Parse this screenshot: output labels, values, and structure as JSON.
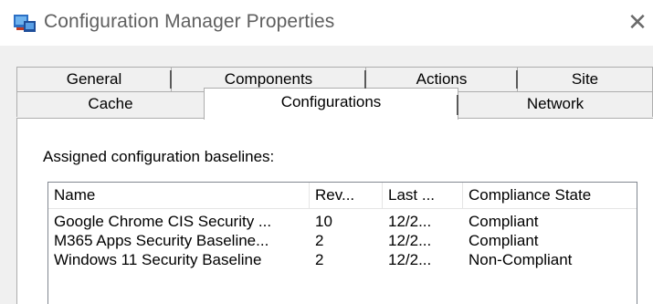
{
  "window": {
    "title": "Configuration Manager Properties",
    "close_glyph": "✕",
    "icon": "configmgr-app-icon"
  },
  "tabs": {
    "row1": [
      "General",
      "Components",
      "Actions",
      "Site"
    ],
    "row2": [
      "Cache",
      "Configurations",
      "Network"
    ],
    "active": "Configurations"
  },
  "panel": {
    "section_label": "Assigned configuration baselines:",
    "columns": [
      "Name",
      "Rev...",
      "Last ...",
      "Compliance State"
    ],
    "rows": [
      {
        "name": "Google Chrome CIS Security ...",
        "rev": "10",
        "last": "12/2...",
        "state": "Compliant"
      },
      {
        "name": "M365 Apps Security Baseline...",
        "rev": "2",
        "last": "12/2...",
        "state": "Compliant"
      },
      {
        "name": "Windows 11 Security Baseline",
        "rev": "2",
        "last": "12/2...",
        "state": "Non-Compliant"
      }
    ]
  },
  "colors": {
    "dialog_bg": "#f0f0f0",
    "content_bg": "#ffffff",
    "title_text": "#5f5f5f"
  }
}
